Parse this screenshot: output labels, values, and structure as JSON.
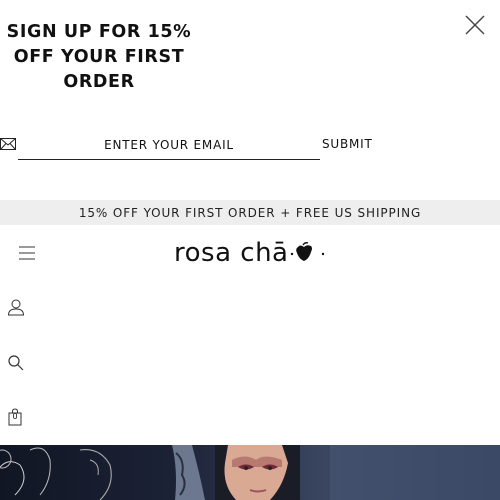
{
  "popup": {
    "heading_line1": "SIGN UP FOR 15%",
    "heading_line2": "OFF YOUR FIRST",
    "heading_line3": "ORDER",
    "email_placeholder": "ENTER YOUR EMAIL",
    "email_value": "",
    "submit_label": "SUBMIT",
    "close_icon": "close-icon",
    "mail_icon": "envelope-icon"
  },
  "announcement": {
    "text": "15% OFF YOUR FIRST ORDER + FREE US SHIPPING"
  },
  "header": {
    "logo_text": "rosa chā",
    "menu_icon": "hamburger-icon",
    "account_icon": "user-icon",
    "search_icon": "search-icon",
    "cart_icon": "shopping-bag-icon",
    "cart_count": "0"
  },
  "colors": {
    "announce_bg": "#eeeeee",
    "text": "#111111",
    "hero_bg": "#20253a"
  }
}
